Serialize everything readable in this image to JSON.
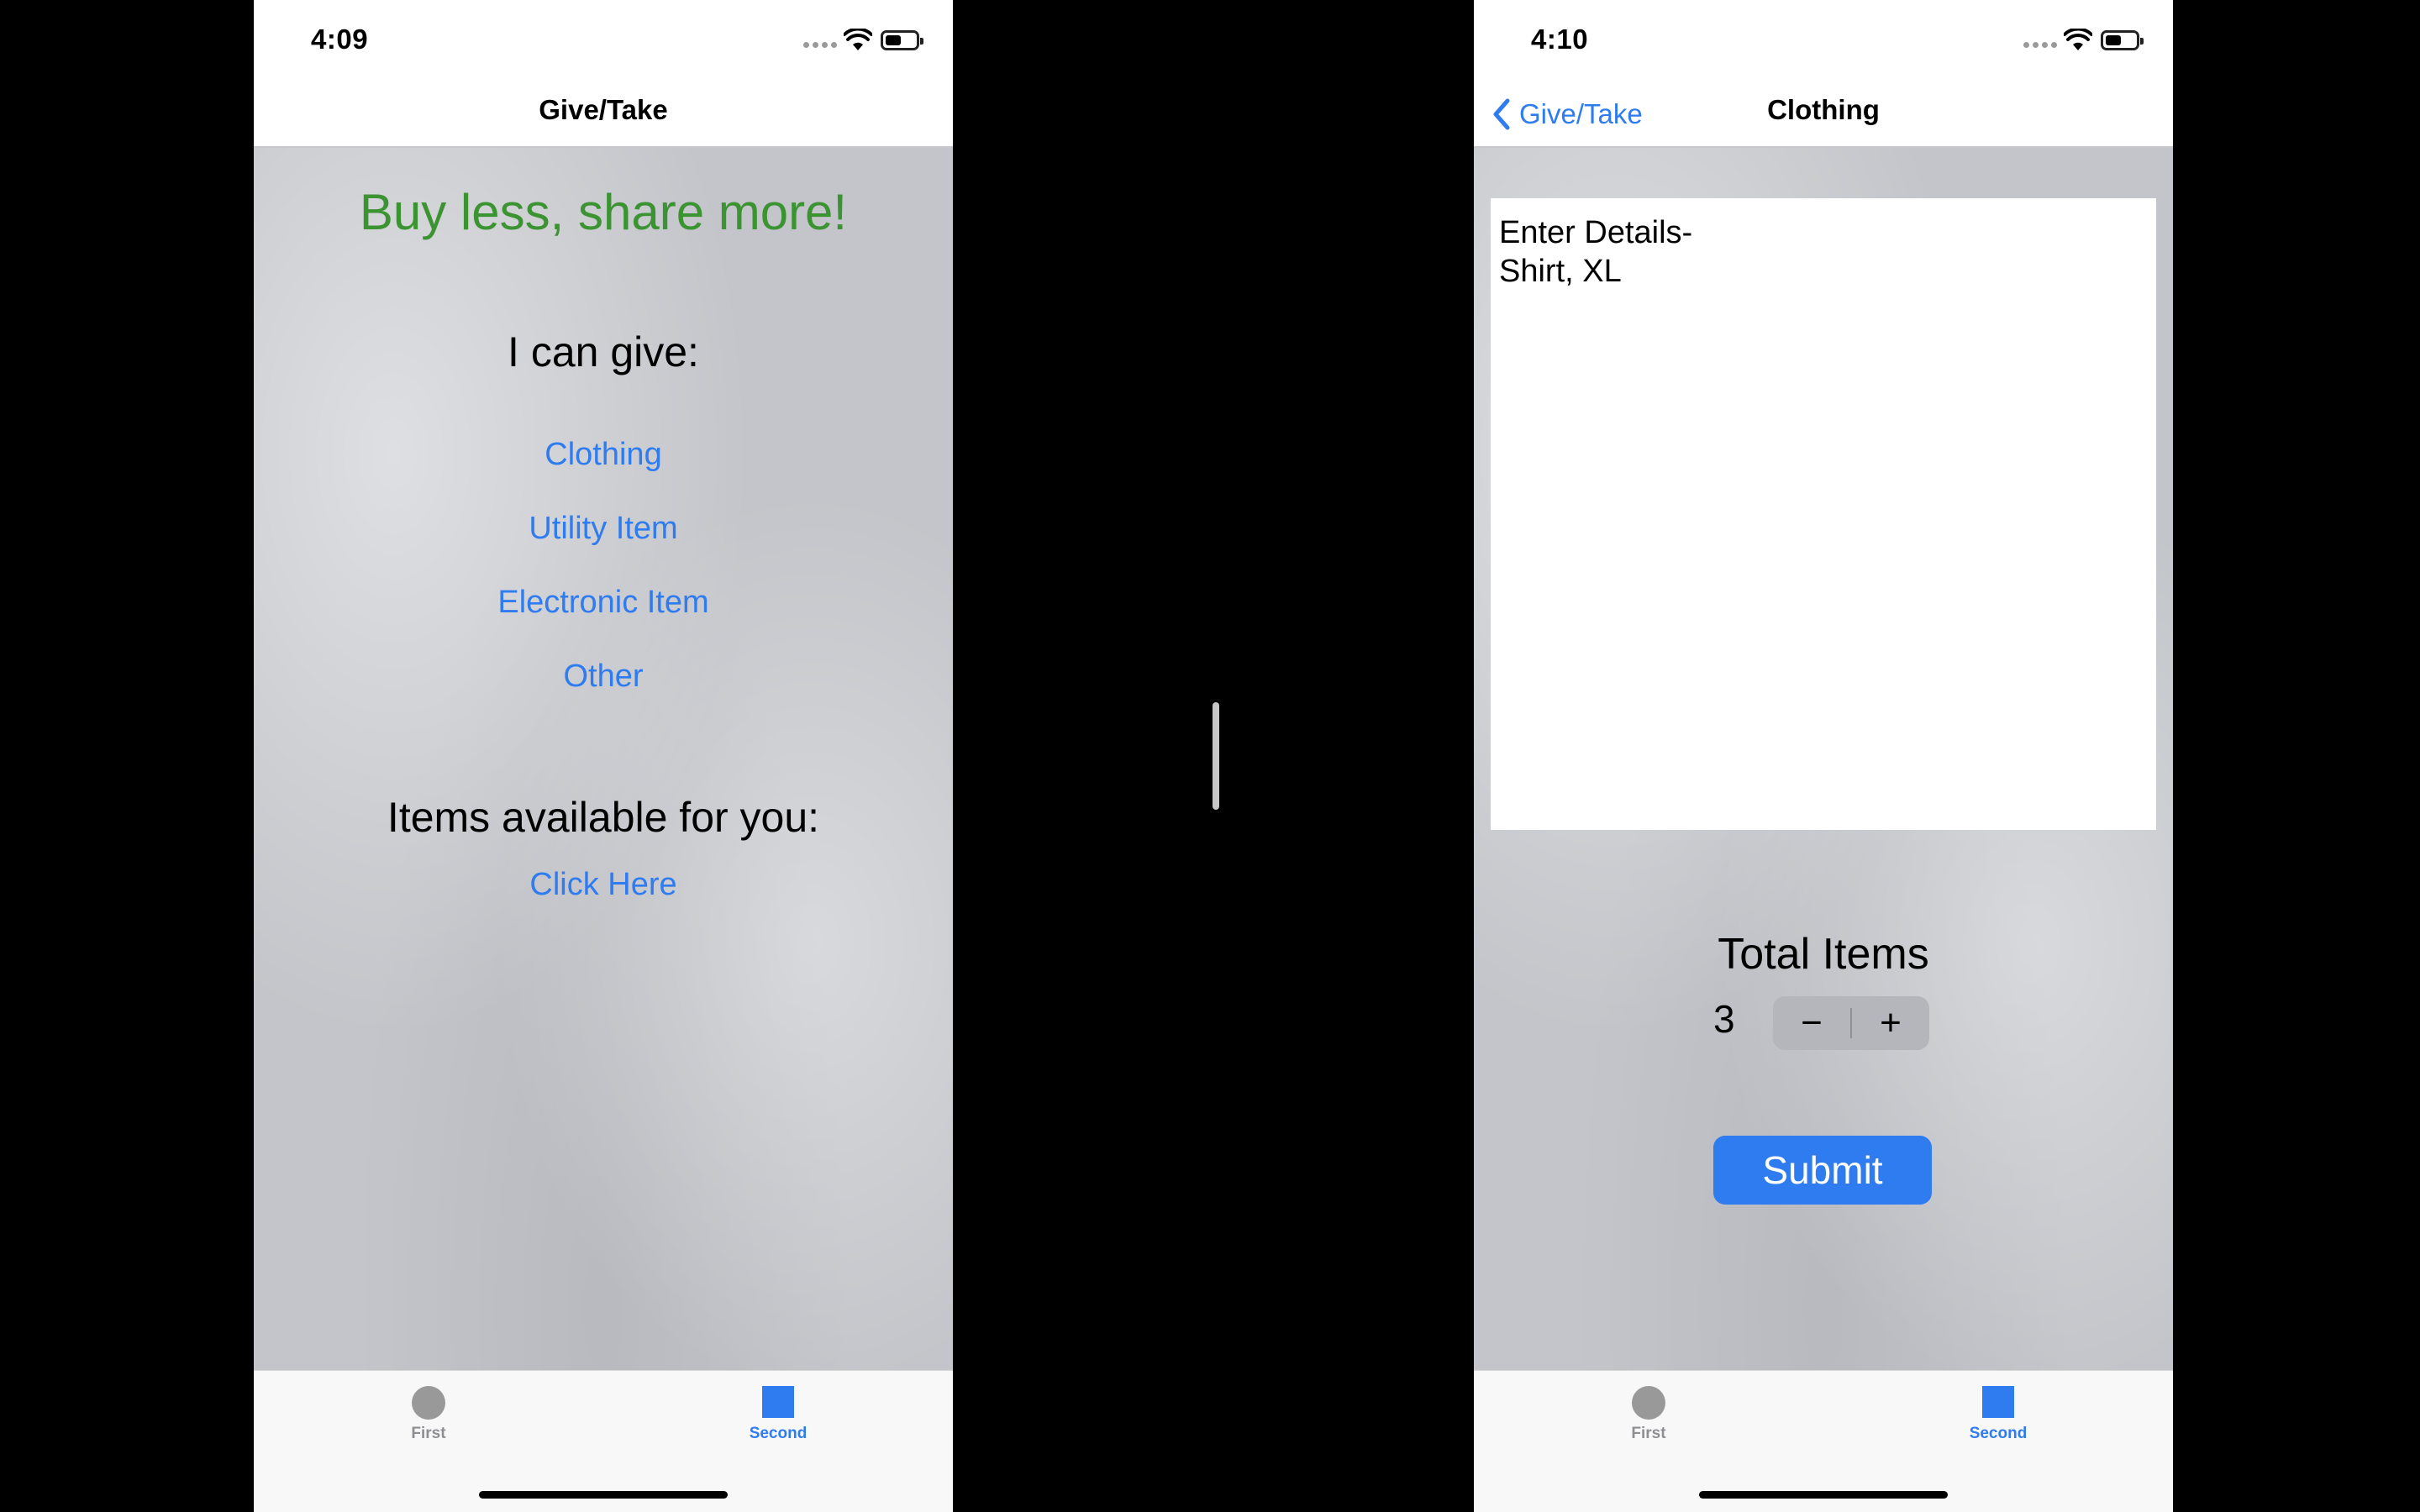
{
  "left_screen": {
    "status": {
      "time": "4:09"
    },
    "nav": {
      "title": "Give/Take"
    },
    "slogan": "Buy less, share more!",
    "give_heading": "I can give:",
    "give_links": [
      "Clothing",
      "Utility Item",
      "Electronic Item",
      "Other"
    ],
    "available_heading": "Items available for you:",
    "available_link": "Click Here",
    "tabs": {
      "first": "First",
      "second": "Second"
    }
  },
  "right_screen": {
    "status": {
      "time": "4:10"
    },
    "nav": {
      "back_label": "Give/Take",
      "title": "Clothing"
    },
    "details_lines": [
      "Enter Details-",
      "Shirt, XL"
    ],
    "total_label": "Total Items",
    "count": "3",
    "stepper": {
      "minus": "−",
      "plus": "+"
    },
    "submit_label": "Submit",
    "tabs": {
      "first": "First",
      "second": "Second"
    }
  },
  "colors": {
    "accent": "#2f7bf0",
    "slogan_green": "#3b9331",
    "background_gray": "#c3c5ca"
  },
  "icons": [
    "signal-icon",
    "wifi-icon",
    "battery-icon",
    "chevron-left-icon",
    "tab-circle-icon",
    "tab-square-icon"
  ]
}
